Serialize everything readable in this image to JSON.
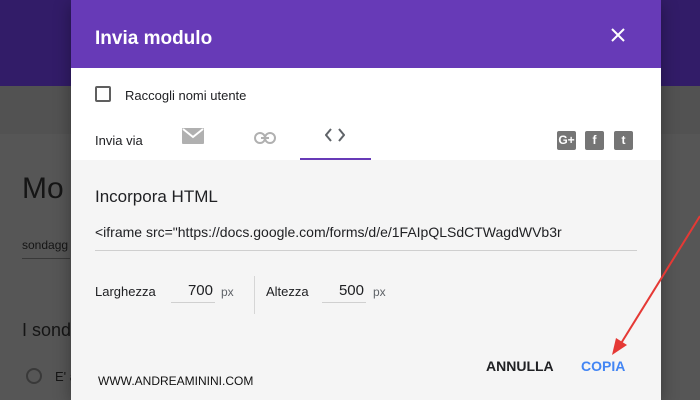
{
  "background": {
    "title_partial": "Mo",
    "subtitle_partial": "sondagg",
    "section_partial": "I sond",
    "option_partial": "E' a"
  },
  "dialog": {
    "title": "Invia modulo",
    "close_icon": "close-icon",
    "collect_usernames_label": "Raccogli nomi utente",
    "send_via_label": "Invia via",
    "tabs": [
      {
        "icon": "email-icon",
        "selected": false
      },
      {
        "icon": "link-icon",
        "selected": false
      },
      {
        "icon": "code-icon",
        "selected": true
      }
    ],
    "social": [
      {
        "icon": "google-plus-icon",
        "text": "G+"
      },
      {
        "icon": "facebook-icon",
        "text": "f"
      },
      {
        "icon": "twitter-icon",
        "text": "t"
      }
    ],
    "embed": {
      "title": "Incorpora HTML",
      "code": "<iframe src=\"https://docs.google.com/forms/d/e/1FAIpQLSdCTWagdWVb3r",
      "width_label": "Larghezza",
      "width_value": "700",
      "height_label": "Altezza",
      "height_value": "500",
      "unit": "px"
    },
    "cancel_label": "ANNULLA",
    "copy_label": "COPIA",
    "watermark": "WWW.ANDREAMININI.COM"
  },
  "colors": {
    "header": "#673ab7",
    "accent": "#673ab7",
    "copy_button": "#4285f4",
    "arrow": "#e53935"
  }
}
